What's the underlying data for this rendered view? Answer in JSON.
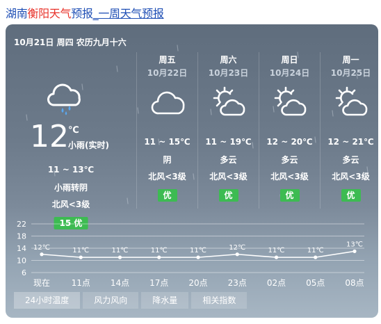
{
  "page_title": {
    "part1": "湖南",
    "part2": "衡阳天气",
    "part3": "预报",
    "link": "_一周天气预报"
  },
  "today": {
    "date_line": "10月21日 周四 农历九月十六",
    "icon": "rain-cloud-icon",
    "temp": "12",
    "unit": "℃",
    "condition_now": "小雨(实时)",
    "range": "11 ~ 13℃",
    "weather": "小雨转阴",
    "wind": "北风<3级",
    "aqi": "15 优"
  },
  "days": [
    {
      "name": "周五",
      "date": "10月22日",
      "icon": "cloudy-icon",
      "range": "11 ~ 15℃",
      "weather": "阴",
      "wind": "北风<3级",
      "aqi": "优"
    },
    {
      "name": "周六",
      "date": "10月23日",
      "icon": "partly-sunny-icon",
      "range": "11 ~ 19℃",
      "weather": "多云",
      "wind": "北风<3级",
      "aqi": "优"
    },
    {
      "name": "周日",
      "date": "10月24日",
      "icon": "partly-sunny-icon",
      "range": "12 ~ 20℃",
      "weather": "多云",
      "wind": "北风<3级",
      "aqi": "优"
    },
    {
      "name": "周一",
      "date": "10月25日",
      "icon": "partly-sunny-icon",
      "range": "12 ~ 21℃",
      "weather": "多云",
      "wind": "北风<3级",
      "aqi": "优"
    }
  ],
  "chart_data": {
    "type": "line",
    "categories": [
      "现在",
      "11点",
      "14点",
      "17点",
      "20点",
      "23点",
      "02点",
      "05点",
      "08点"
    ],
    "series": [
      {
        "values": [
          12,
          11,
          11,
          11,
          11,
          12,
          11,
          11,
          13
        ]
      }
    ],
    "data_labels": [
      "12℃",
      "11℃",
      "11℃",
      "11℃",
      "11℃",
      "12℃",
      "11℃",
      "11℃",
      "13℃"
    ],
    "yticks": [
      22,
      18,
      14,
      10,
      6
    ],
    "ylim": [
      6,
      22
    ],
    "grid": true,
    "colors": {
      "line": "#ffffff",
      "grid": "#ffffff"
    }
  },
  "tabs": [
    "24小时温度",
    "风力风向",
    "降水量",
    "相关指数"
  ],
  "colors": {
    "aqi_badge": "#3dbb52",
    "title_link": "#1f4fb5",
    "title_highlight": "#e8322a"
  }
}
